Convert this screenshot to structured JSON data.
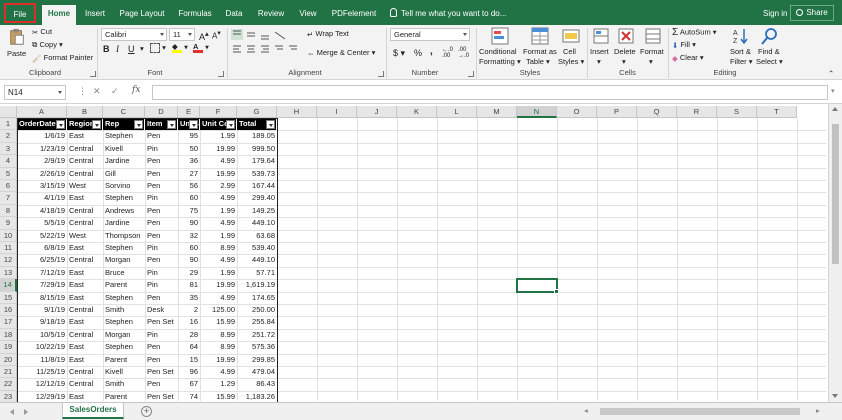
{
  "ribbon_tabs": [
    "File",
    "Home",
    "Insert",
    "Page Layout",
    "Formulas",
    "Data",
    "Review",
    "View",
    "PDFelement"
  ],
  "tell_me": "Tell me what you want to do...",
  "sign_in": "Sign in",
  "share": "Share",
  "clipboard": {
    "paste": "Paste",
    "cut": "Cut",
    "copy": "Copy",
    "format_painter": "Format Painter",
    "label": "Clipboard"
  },
  "font": {
    "name": "Calibri",
    "size": "11",
    "bold": "B",
    "italic": "I",
    "underline": "U",
    "label": "Font"
  },
  "alignment": {
    "wrap": "Wrap Text",
    "merge": "Merge & Center",
    "label": "Alignment"
  },
  "number": {
    "format": "General",
    "currency": "$",
    "percent": "%",
    "comma": ",",
    "label": "Number"
  },
  "styles": {
    "conditional": "Conditional",
    "conditional2": "Formatting",
    "format_as": "Format as",
    "format_as2": "Table",
    "cell": "Cell",
    "cell2": "Styles",
    "label": "Styles"
  },
  "cells": {
    "insert": "Insert",
    "delete": "Delete",
    "format": "Format",
    "label": "Cells"
  },
  "editing": {
    "autosum": "AutoSum",
    "fill": "Fill",
    "clear": "Clear",
    "sort": "Sort &",
    "sort2": "Filter",
    "find": "Find &",
    "find2": "Select",
    "label": "Editing"
  },
  "name_box": "N14",
  "fx": "fx",
  "columns": [
    "A",
    "B",
    "C",
    "D",
    "E",
    "F",
    "G",
    "H",
    "I",
    "J",
    "K",
    "L",
    "M",
    "N",
    "O",
    "P",
    "Q",
    "R",
    "S",
    "T"
  ],
  "selected_column": "N",
  "selected_row": 14,
  "table_headers": [
    "OrderDate",
    "Region",
    "Rep",
    "Item",
    "Units",
    "Unit Cost",
    "Total"
  ],
  "rows": [
    [
      "1/6/19",
      "East",
      "Stephen",
      "Pen",
      "95",
      "1.99",
      "189.05"
    ],
    [
      "1/23/19",
      "Central",
      "Kivell",
      "Pin",
      "50",
      "19.99",
      "999.50"
    ],
    [
      "2/9/19",
      "Central",
      "Jardine",
      "Pen",
      "36",
      "4.99",
      "179.64"
    ],
    [
      "2/26/19",
      "Central",
      "Gill",
      "Pen",
      "27",
      "19.99",
      "539.73"
    ],
    [
      "3/15/19",
      "West",
      "Sorvino",
      "Pen",
      "56",
      "2.99",
      "167.44"
    ],
    [
      "4/1/19",
      "East",
      "Stephen",
      "Pin",
      "60",
      "4.99",
      "299.40"
    ],
    [
      "4/18/19",
      "Central",
      "Andrews",
      "Pen",
      "75",
      "1.99",
      "149.25"
    ],
    [
      "5/5/19",
      "Central",
      "Jardine",
      "Pen",
      "90",
      "4.99",
      "449.10"
    ],
    [
      "5/22/19",
      "West",
      "Thompson",
      "Pen",
      "32",
      "1.99",
      "63.68"
    ],
    [
      "6/8/19",
      "East",
      "Stephen",
      "Pin",
      "60",
      "8.99",
      "539.40"
    ],
    [
      "6/25/19",
      "Central",
      "Morgan",
      "Pen",
      "90",
      "4.99",
      "449.10"
    ],
    [
      "7/12/19",
      "East",
      "Bruce",
      "Pin",
      "29",
      "1.99",
      "57.71"
    ],
    [
      "7/29/19",
      "East",
      "Parent",
      "Pin",
      "81",
      "19.99",
      "1,619.19"
    ],
    [
      "8/15/19",
      "East",
      "Stephen",
      "Pen",
      "35",
      "4.99",
      "174.65"
    ],
    [
      "9/1/19",
      "Central",
      "Smith",
      "Desk",
      "2",
      "125.00",
      "250.00"
    ],
    [
      "9/18/19",
      "East",
      "Stephen",
      "Pen Set",
      "16",
      "15.99",
      "255.84"
    ],
    [
      "10/5/19",
      "Central",
      "Morgan",
      "Pin",
      "28",
      "8.99",
      "251.72"
    ],
    [
      "10/22/19",
      "East",
      "Stephen",
      "Pen",
      "64",
      "8.99",
      "575.36"
    ],
    [
      "11/8/19",
      "East",
      "Parent",
      "Pen",
      "15",
      "19.99",
      "299.85"
    ],
    [
      "11/25/19",
      "Central",
      "Kivell",
      "Pen Set",
      "96",
      "4.99",
      "479.04"
    ],
    [
      "12/12/19",
      "Central",
      "Smith",
      "Pen",
      "67",
      "1.29",
      "86.43"
    ],
    [
      "12/29/19",
      "East",
      "Parent",
      "Pen Set",
      "74",
      "15.99",
      "1,183.26"
    ]
  ],
  "sheet_tab": "SalesOrders",
  "add_sheet": "+"
}
